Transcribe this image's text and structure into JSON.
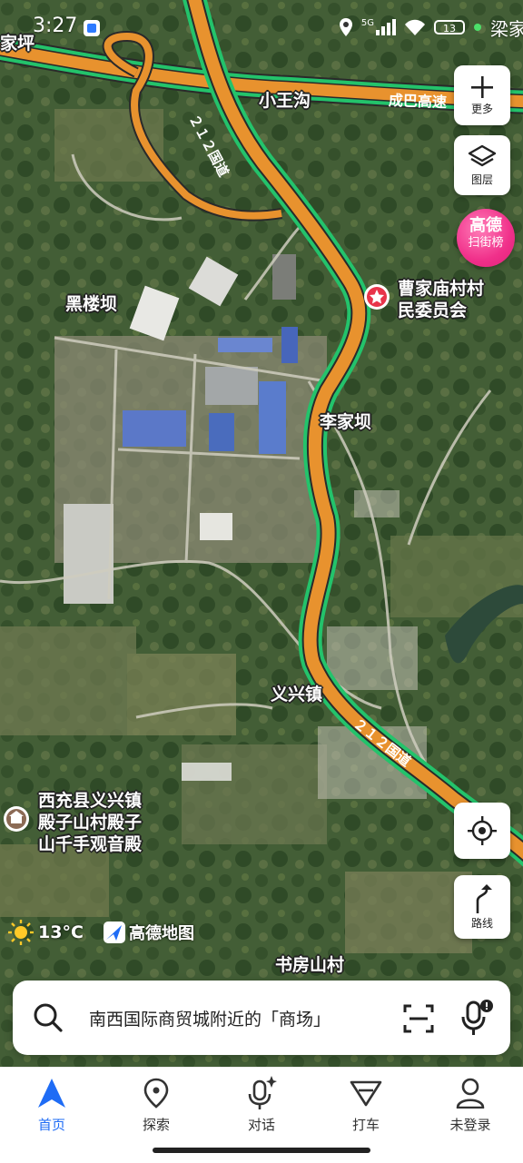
{
  "status_bar": {
    "time": "3:27",
    "network": "5G",
    "battery": "13",
    "carrier": "梁家"
  },
  "map": {
    "place_labels": [
      "家坪",
      "小王沟",
      "黑楼坝",
      "李家坝",
      "义兴镇",
      "书房山村"
    ],
    "road_labels": {
      "expressway": "成巴高速",
      "national_road_north": "２１２国道",
      "national_road_south": "２１２国道"
    },
    "poi_village_committee": "曹家庙村村\n民委员会",
    "poi_temple": "西充县义兴镇\n殿子山村殿子\n山千手观音殿"
  },
  "controls": {
    "more_label": "更多",
    "layers_label": "图层",
    "promo_line1": "高德",
    "promo_line2": "扫街榜",
    "route_label": "路线"
  },
  "weather": {
    "temperature": "13°C",
    "icon": "sun-icon"
  },
  "brand": "高德地图",
  "search": {
    "placeholder": "南西国际商贸城附近的「商场」",
    "icons": [
      "search-icon",
      "scan-icon",
      "voice-icon"
    ]
  },
  "nav": {
    "items": [
      {
        "label": "首页",
        "icon": "home-arrow-icon",
        "active": true
      },
      {
        "label": "探索",
        "icon": "location-pin-icon"
      },
      {
        "label": "对话",
        "icon": "ai-mic-icon"
      },
      {
        "label": "打车",
        "icon": "taxi-icon"
      },
      {
        "label": "未登录",
        "icon": "user-icon"
      }
    ]
  },
  "colors": {
    "accent": "#1f6cf5",
    "road_orange": "#e8922e",
    "traffic_green": "#23c36b",
    "poi_red": "#e8344a"
  }
}
